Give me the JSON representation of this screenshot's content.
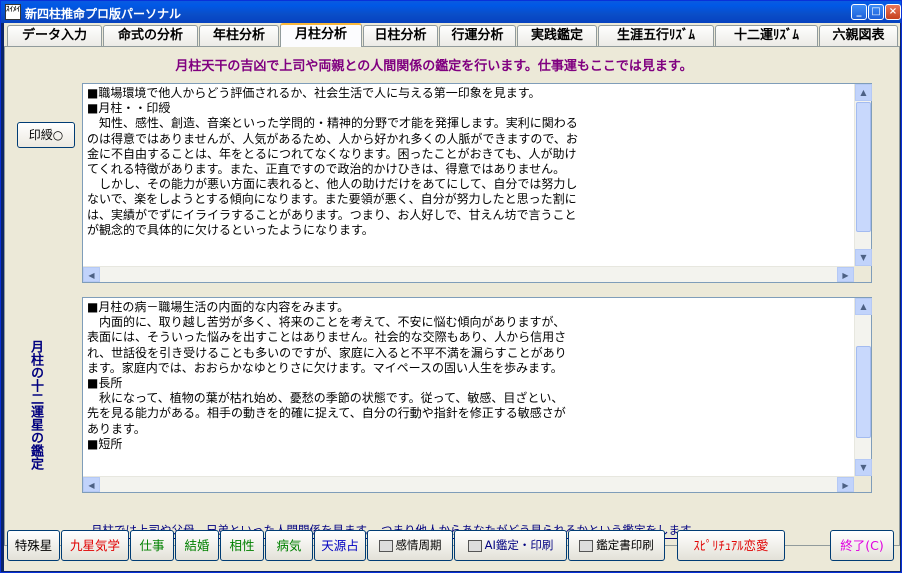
{
  "window": {
    "icon_text": "ｽｲﾒｲ",
    "title": "新四柱推命プロ版パーソナル",
    "minimize_glyph": "_",
    "maximize_glyph": "□",
    "close_glyph": "×"
  },
  "tabs": [
    {
      "label": "データ入力"
    },
    {
      "label": "命式の分析"
    },
    {
      "label": "年柱分析"
    },
    {
      "label": "月柱分析",
      "active": true
    },
    {
      "label": "日柱分析"
    },
    {
      "label": "行運分析"
    },
    {
      "label": "実践鑑定"
    },
    {
      "label": "生涯五行ﾘｽﾞﾑ"
    },
    {
      "label": "十二運ﾘｽﾞﾑ"
    },
    {
      "label": "六親図表"
    }
  ],
  "main": {
    "heading": "月柱天干の吉凶で上司や両親との人間関係の鑑定を行います。仕事運もここでは見ます。",
    "print_button": "印綬○",
    "text1": "■職場環境で他人からどう評価されるか、社会生活で人に与える第一印象を見ます。\n■月柱・・印綬\n　知性、感性、創造、音楽といった学問的・精神的分野で才能を発揮します。実利に関わる\nのは得意ではありませんが、人気があるため、人から好かれ多くの人脈ができますので、お\n金に不自由することは、年をとるにつれてなくなります。困ったことがおきても、人が助け\nてくれる特徴があります。また、正直ですので政治的かけひきは、得意ではありません。\n　しかし、その能力が悪い方面に表れると、他人の助けだけをあてにして、自分では努力し\nないで、楽をしようとする傾向になります。また要領が悪く、自分が努力したと思った割に\nは、実績がでずにイライラすることがあります。つまり、お人好しで、甘えん坊で言うこと\nが観念的で具体的に欠けるといったようになります。",
    "vertical_label": "月柱の十二運星の鑑定",
    "text2": "■月柱の病－職場生活の内面的な内容をみます。\n　内面的に、取り越し苦労が多く、将来のことを考えて、不安に悩む傾向がありますが、\n表面には、そういった悩みを出すことはありません。社会的な交際もあり、人から信用さ\nれ、世話役を引き受けることも多いのですが、家庭に入ると不平不満を漏らすことがあり\nます。家庭内では、おおらかなゆとりさに欠けます。マイペースの固い人生を歩みます。\n■長所\n　秋になって、植物の葉が枯れ始め、憂愁の季節の状態です。従って、敏感、目ざとい、\n先を見る能力がある。相手の動きを的確に捉えて、自分の行動や指針を修正する敏感さが\nあります。\n■短所",
    "footnote": "月柱では上司や父母、兄弟といった人間関係を見ます。 つまり他人からあなたがどう見られるかという鑑定をします。"
  },
  "bottom_buttons": [
    {
      "label": "特殊星",
      "color": "#000000"
    },
    {
      "label": "九星気学",
      "color": "#e00000"
    },
    {
      "label": "仕事",
      "color": "#008000"
    },
    {
      "label": "結婚",
      "color": "#008000"
    },
    {
      "label": "相性",
      "color": "#008000"
    },
    {
      "label": "病気",
      "color": "#008000"
    },
    {
      "label": "天源占",
      "color": "#0000c0"
    },
    {
      "label": "感情周期",
      "color": "#000000"
    },
    {
      "label": "AI鑑定・印刷",
      "color": "#000080"
    },
    {
      "label": "鑑定書印刷",
      "color": "#000000"
    },
    {
      "label": "ｽﾋﾟﾘﾁｭｱﾙ恋愛",
      "color": "#e00000"
    },
    {
      "label": "終了(C)",
      "color": "#e000e0"
    }
  ]
}
